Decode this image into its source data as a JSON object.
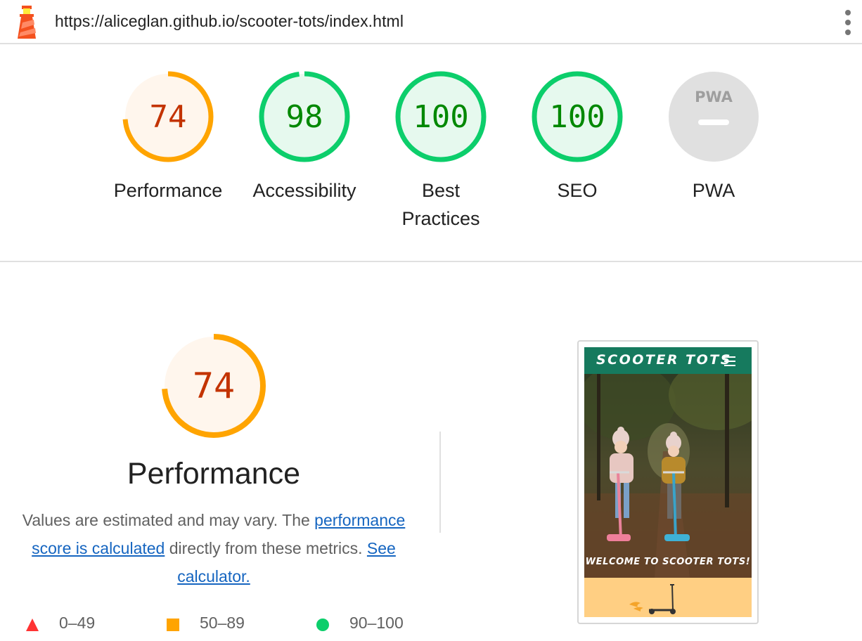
{
  "topbar": {
    "url": "https://aliceglan.github.io/scooter-tots/index.html",
    "logo_icon": "lighthouse-icon",
    "menu_icon": "kebab-menu-icon"
  },
  "scores": [
    {
      "score": "74",
      "label": "Performance",
      "status": "average",
      "fraction": 0.74
    },
    {
      "score": "98",
      "label": "Accessibility",
      "status": "pass",
      "fraction": 0.98
    },
    {
      "score": "100",
      "label": "Best Practices",
      "status": "pass",
      "fraction": 1.0
    },
    {
      "score": "100",
      "label": "SEO",
      "status": "pass",
      "fraction": 1.0
    },
    {
      "score": "",
      "label": "PWA",
      "status": "na",
      "badge_text": "PWA",
      "fraction": 0
    }
  ],
  "performance": {
    "score": "74",
    "fraction": 0.74,
    "title": "Performance",
    "desc_part1": "Values are estimated and may vary. The ",
    "desc_link1": "performance score is calculated",
    "desc_part2": " directly from these metrics. ",
    "desc_link2": "See calculator."
  },
  "legend": [
    {
      "range": "0–49",
      "shape": "triangle",
      "color": "#ff3333"
    },
    {
      "range": "50–89",
      "shape": "square",
      "color": "#ffa400"
    },
    {
      "range": "90–100",
      "shape": "circle",
      "color": "#0cce6b"
    }
  ],
  "screenshot": {
    "brand": "SCOOTER TOTS",
    "welcome": "WELCOME TO SCOOTER TOTS!",
    "nav_color": "#167a5e",
    "footer_color": "#ffcf83"
  },
  "colors": {
    "average": "#ffa400",
    "average_text": "#c33300",
    "average_bg": "#fff6ed",
    "pass": "#0cce6b",
    "pass_text": "#008800",
    "pass_bg": "#e6f9ee",
    "na": "#e0e0e0"
  }
}
